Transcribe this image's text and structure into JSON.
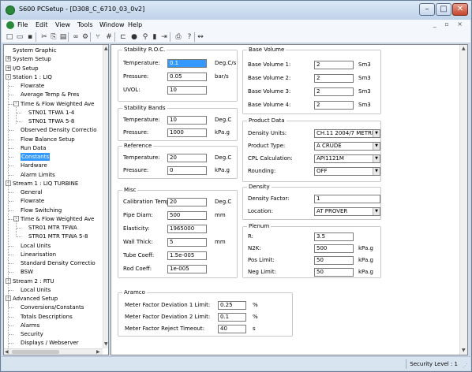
{
  "window": {
    "title": "S600 PCSetup  - [D308_C_6710_03_0v2]",
    "min_glyph": "–",
    "max_glyph": "□",
    "close_glyph": "✕",
    "mdi_glyphs": "_ ▫ ×"
  },
  "menu": [
    "File",
    "Edit",
    "View",
    "Tools",
    "Window",
    "Help"
  ],
  "toolbar": {
    "icons": [
      "new-file-icon",
      "open-folder-icon",
      "save-icon",
      "cut-icon",
      "copy-icon",
      "paste-icon",
      "link-icon",
      "settings-icon",
      "flowchart-icon",
      "hash-icon",
      "station-icon",
      "stop-icon",
      "pin-icon",
      "green-bar-icon",
      "connect-icon",
      "print-icon",
      "help-icon",
      "arrows-icon"
    ],
    "glyphs": [
      "□",
      "▭",
      "▪",
      "✂",
      "⎘",
      "▤",
      "∞",
      "⚙",
      "⑂",
      "#",
      "⊏",
      "●",
      "⚲",
      "▮",
      "⇥",
      "⎙",
      "?",
      "↭"
    ]
  },
  "tree": {
    "items": [
      {
        "label": "System Graphic",
        "indent": 0,
        "expander": ""
      },
      {
        "label": "System Setup",
        "indent": 0,
        "expander": "+"
      },
      {
        "label": "I/O Setup",
        "indent": 0,
        "expander": "+"
      },
      {
        "label": "Station 1 : LIQ",
        "indent": 0,
        "expander": "-"
      },
      {
        "label": "Flowrate",
        "indent": 1,
        "expander": ""
      },
      {
        "label": "Average Temp & Pres",
        "indent": 1,
        "expander": ""
      },
      {
        "label": "Time & Flow Weighted Ave",
        "indent": 1,
        "expander": "-"
      },
      {
        "label": "STN01 TFWA 1-4",
        "indent": 2,
        "expander": ""
      },
      {
        "label": "STN01 TFWA 5-8",
        "indent": 2,
        "expander": ""
      },
      {
        "label": "Observed Density Correctio",
        "indent": 1,
        "expander": ""
      },
      {
        "label": "Flow Balance Setup",
        "indent": 1,
        "expander": ""
      },
      {
        "label": "Run Data",
        "indent": 1,
        "expander": ""
      },
      {
        "label": "Constants",
        "indent": 1,
        "expander": "",
        "selected": true
      },
      {
        "label": "Hardware",
        "indent": 1,
        "expander": ""
      },
      {
        "label": "Alarm Limits",
        "indent": 1,
        "expander": ""
      },
      {
        "label": "Stream 1 : LIQ TURBINE",
        "indent": 0,
        "expander": "-"
      },
      {
        "label": "General",
        "indent": 1,
        "expander": ""
      },
      {
        "label": "Flowrate",
        "indent": 1,
        "expander": ""
      },
      {
        "label": "Flow Switching",
        "indent": 1,
        "expander": ""
      },
      {
        "label": "Time & Flow Weighted Ave",
        "indent": 1,
        "expander": "-"
      },
      {
        "label": "STR01 MTR TFWA",
        "indent": 2,
        "expander": ""
      },
      {
        "label": "STR01 MTR TFWA 5-8",
        "indent": 2,
        "expander": ""
      },
      {
        "label": "Local Units",
        "indent": 1,
        "expander": ""
      },
      {
        "label": "Linearisation",
        "indent": 1,
        "expander": ""
      },
      {
        "label": "Standard Density Correctio",
        "indent": 1,
        "expander": ""
      },
      {
        "label": "BSW",
        "indent": 1,
        "expander": ""
      },
      {
        "label": "Stream 2 : RTU",
        "indent": 0,
        "expander": "-"
      },
      {
        "label": "Local Units",
        "indent": 1,
        "expander": ""
      },
      {
        "label": "Advanced Setup",
        "indent": 0,
        "expander": "-"
      },
      {
        "label": "Conversions/Constants",
        "indent": 1,
        "expander": ""
      },
      {
        "label": "Totals Descriptions",
        "indent": 1,
        "expander": ""
      },
      {
        "label": "Alarms",
        "indent": 1,
        "expander": ""
      },
      {
        "label": "Security",
        "indent": 1,
        "expander": ""
      },
      {
        "label": "Displays / Webserver",
        "indent": 1,
        "expander": ""
      }
    ]
  },
  "groups": {
    "stability_roc": {
      "title": "Stability R.O.C.",
      "rows": [
        {
          "label": "Temperature:",
          "value": "0.1",
          "unit": "Deg.C/s",
          "highlight": true
        },
        {
          "label": "Pressure:",
          "value": "0.05",
          "unit": "bar/s"
        },
        {
          "label": "UVOL:",
          "value": "10",
          "unit": ""
        }
      ]
    },
    "stability_bands": {
      "title": "Stability Bands",
      "rows": [
        {
          "label": "Temperature:",
          "value": "10",
          "unit": "Deg.C"
        },
        {
          "label": "Pressure:",
          "value": "1000",
          "unit": "kPa.g"
        }
      ]
    },
    "reference": {
      "title": "Reference",
      "rows": [
        {
          "label": "Temperature:",
          "value": "20",
          "unit": "Deg.C"
        },
        {
          "label": "Pressure:",
          "value": "0",
          "unit": "kPa.g"
        }
      ]
    },
    "misc": {
      "title": "Misc",
      "rows": [
        {
          "label": "Calibration Temp:",
          "value": "20",
          "unit": "Deg.C"
        },
        {
          "label": "Pipe Diam:",
          "value": "500",
          "unit": "mm"
        },
        {
          "label": "Elasticity:",
          "value": "1965000",
          "unit": ""
        },
        {
          "label": "Wall Thick:",
          "value": "5",
          "unit": "mm"
        },
        {
          "label": "Tube Coeff:",
          "value": "1.5e-005",
          "unit": ""
        },
        {
          "label": "Rod Coeff:",
          "value": "1e-005",
          "unit": ""
        }
      ]
    },
    "base_volume": {
      "title": "Base Volume",
      "rows": [
        {
          "label": "Base Volume 1:",
          "value": "2",
          "unit": "Sm3"
        },
        {
          "label": "Base Volume 2:",
          "value": "2",
          "unit": "Sm3"
        },
        {
          "label": "Base Volume 3:",
          "value": "2",
          "unit": "Sm3"
        },
        {
          "label": "Base Volume 4:",
          "value": "2",
          "unit": "Sm3"
        }
      ]
    },
    "product_data": {
      "title": "Product Data",
      "rows": [
        {
          "label": "Density Units:",
          "value": "CH.11 2004/7 METRIC"
        },
        {
          "label": "Product Type:",
          "value": "A CRUDE"
        },
        {
          "label": "CPL Calculation:",
          "value": "API1121M"
        },
        {
          "label": "Rounding:",
          "value": "OFF"
        }
      ]
    },
    "density": {
      "title": "Density",
      "rows": [
        {
          "label": "Density Factor:",
          "value": "1"
        },
        {
          "label": "Location:",
          "value": "AT PROVER"
        }
      ]
    },
    "plenum": {
      "title": "Plenum",
      "rows": [
        {
          "label": "R:",
          "value": "3.5",
          "unit": ""
        },
        {
          "label": "N2K:",
          "value": "500",
          "unit": "kPa.g"
        },
        {
          "label": "Pos Limit:",
          "value": "50",
          "unit": "kPa.g"
        },
        {
          "label": "Neg Limit:",
          "value": "50",
          "unit": "kPa.g"
        }
      ]
    },
    "aramco": {
      "title": "Aramco",
      "rows": [
        {
          "label": "Meter Factor Deviation 1 Limit:",
          "value": "0.25",
          "unit": "%"
        },
        {
          "label": "Meter Factor Deviation 2 Limit:",
          "value": "0.1",
          "unit": "%"
        },
        {
          "label": "Meter Factor Reject Timeout:",
          "value": "40",
          "unit": "s"
        }
      ]
    }
  },
  "status": {
    "security": "Security Level : 1"
  }
}
